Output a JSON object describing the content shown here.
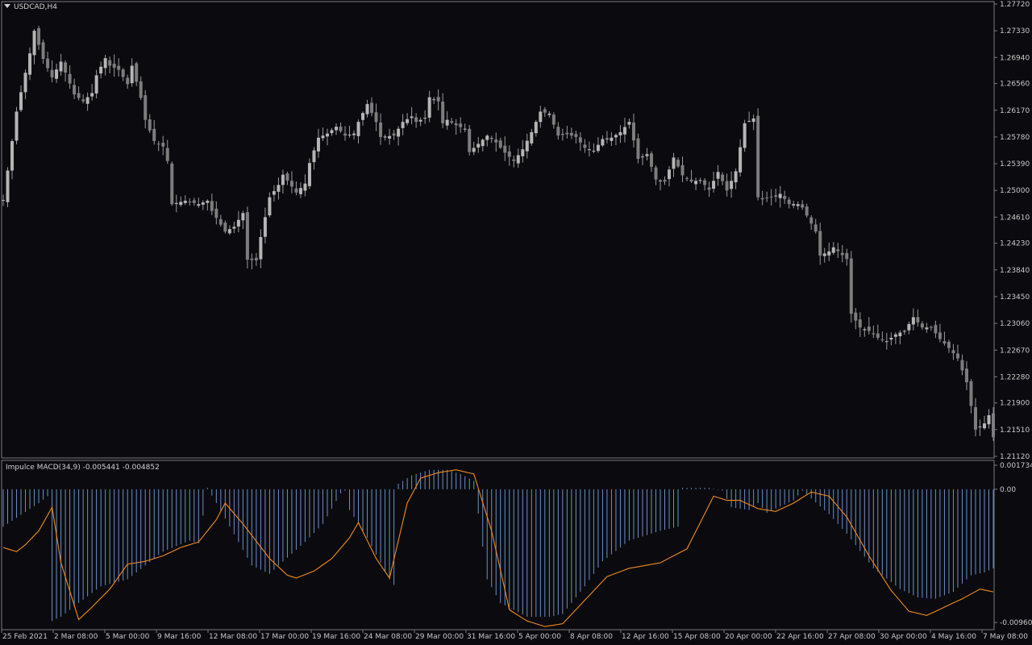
{
  "main_chart": {
    "symbol_label": "USDCAD,H4",
    "price_ticks": [
      "1.27720",
      "1.27330",
      "1.26940",
      "1.26560",
      "1.26170",
      "1.25780",
      "1.25390",
      "1.25000",
      "1.24610",
      "1.24230",
      "1.23840",
      "1.23450",
      "1.23060",
      "1.22670",
      "1.22280",
      "1.21900",
      "1.21510",
      "1.21120"
    ]
  },
  "indicator": {
    "label": "Impulce MACD(34,9) -0.005441 -0.004852",
    "value_ticks": [
      "0.001734",
      "0.00",
      "-0.009605"
    ],
    "histogram_color": "#6b8fc7",
    "signal_color": "#f28a1e"
  },
  "time_axis": {
    "labels": [
      "25 Feb 2021",
      "2 Mar 08:00",
      "5 Mar 00:00",
      "9 Mar 16:00",
      "12 Mar 08:00",
      "17 Mar 00:00",
      "19 Mar 16:00",
      "24 Mar 08:00",
      "29 Mar 00:00",
      "31 Mar 16:00",
      "5 Apr 00:00",
      "8 Apr 08:00",
      "12 Apr 16:00",
      "15 Apr 08:00",
      "20 Apr 00:00",
      "22 Apr 16:00",
      "27 Apr 08:00",
      "30 Apr 00:00",
      "4 May 16:00",
      "7 May 08:00"
    ]
  },
  "chart_data": {
    "type": "candlestick",
    "symbol": "USDCAD",
    "timeframe": "H4",
    "ylim": [
      1.2112,
      1.2772
    ],
    "close_path": [
      [
        0,
        1.2486
      ],
      [
        3,
        1.2615
      ],
      [
        6,
        1.27
      ],
      [
        7,
        1.2733
      ],
      [
        9,
        1.2692
      ],
      [
        11,
        1.2665
      ],
      [
        13,
        1.2688
      ],
      [
        16,
        1.264
      ],
      [
        18,
        1.263
      ],
      [
        20,
        1.2642
      ],
      [
        21,
        1.2668
      ],
      [
        23,
        1.2693
      ],
      [
        24,
        1.2682
      ],
      [
        26,
        1.2676
      ],
      [
        28,
        1.2655
      ],
      [
        29,
        1.2682
      ],
      [
        31,
        1.2635
      ],
      [
        32,
        1.2603
      ],
      [
        34,
        1.2572
      ],
      [
        36,
        1.2564
      ],
      [
        37,
        1.2543
      ],
      [
        38,
        1.248
      ],
      [
        41,
        1.2485
      ],
      [
        44,
        1.248
      ],
      [
        46,
        1.2485
      ],
      [
        47,
        1.247
      ],
      [
        50,
        1.244
      ],
      [
        52,
        1.2447
      ],
      [
        54,
        1.2467
      ],
      [
        55,
        1.2399
      ],
      [
        57,
        1.2398
      ],
      [
        58,
        1.2432
      ],
      [
        60,
        1.249
      ],
      [
        62,
        1.2508
      ],
      [
        63,
        1.2523
      ],
      [
        66,
        1.2497
      ],
      [
        68,
        1.251
      ],
      [
        69,
        1.254
      ],
      [
        71,
        1.2577
      ],
      [
        73,
        1.2583
      ],
      [
        75,
        1.2593
      ],
      [
        77,
        1.258
      ],
      [
        79,
        1.2583
      ],
      [
        80,
        1.26
      ],
      [
        82,
        1.2626
      ],
      [
        84,
        1.26
      ],
      [
        85,
        1.2578
      ],
      [
        88,
        1.258
      ],
      [
        90,
        1.26
      ],
      [
        92,
        1.2608
      ],
      [
        93,
        1.26
      ],
      [
        95,
        1.2606
      ],
      [
        96,
        1.2636
      ],
      [
        98,
        1.263
      ],
      [
        99,
        1.2598
      ],
      [
        100,
        1.2603
      ],
      [
        102,
        1.2595
      ],
      [
        104,
        1.259
      ],
      [
        105,
        1.2556
      ],
      [
        107,
        1.2568
      ],
      [
        109,
        1.258
      ],
      [
        111,
        1.257
      ],
      [
        113,
        1.2555
      ],
      [
        115,
        1.2543
      ],
      [
        117,
        1.256
      ],
      [
        119,
        1.2585
      ],
      [
        121,
        1.2615
      ],
      [
        123,
        1.2612
      ],
      [
        125,
        1.258
      ],
      [
        127,
        1.2582
      ],
      [
        129,
        1.2578
      ],
      [
        131,
        1.2562
      ],
      [
        133,
        1.2558
      ],
      [
        135,
        1.2575
      ],
      [
        137,
        1.2577
      ],
      [
        139,
        1.2585
      ],
      [
        141,
        1.26
      ],
      [
        143,
        1.2546
      ],
      [
        145,
        1.2553
      ],
      [
        147,
        1.2516
      ],
      [
        149,
        1.2513
      ],
      [
        151,
        1.2548
      ],
      [
        153,
        1.2522
      ],
      [
        155,
        1.2513
      ],
      [
        157,
        1.2515
      ],
      [
        159,
        1.2501
      ],
      [
        161,
        1.2527
      ],
      [
        163,
        1.25
      ],
      [
        165,
        1.2528
      ],
      [
        167,
        1.2598
      ],
      [
        169,
        1.2605
      ],
      [
        170,
        1.249
      ],
      [
        171,
        1.2487
      ],
      [
        173,
        1.249
      ],
      [
        175,
        1.2495
      ],
      [
        177,
        1.248
      ],
      [
        179,
        1.248
      ],
      [
        180,
        1.2475
      ],
      [
        183,
        1.244
      ],
      [
        184,
        1.2405
      ],
      [
        186,
        1.2411
      ],
      [
        187,
        1.2417
      ],
      [
        190,
        1.24
      ],
      [
        191,
        1.232
      ],
      [
        193,
        1.23
      ],
      [
        195,
        1.2295
      ],
      [
        197,
        1.2285
      ],
      [
        199,
        1.228
      ],
      [
        201,
        1.229
      ],
      [
        203,
        1.2295
      ],
      [
        205,
        1.2315
      ],
      [
        207,
        1.23
      ],
      [
        209,
        1.23
      ],
      [
        211,
        1.2283
      ],
      [
        213,
        1.227
      ],
      [
        215,
        1.2255
      ],
      [
        217,
        1.222
      ],
      [
        219,
        1.2151
      ],
      [
        221,
        1.216
      ],
      [
        222,
        1.2172
      ],
      [
        223,
        1.214
      ]
    ],
    "indicator": {
      "name": "Impulce MACD",
      "params": [
        34,
        9
      ],
      "main_value": -0.005441,
      "signal_value": -0.004852,
      "ylim": [
        -0.009605,
        0.001734
      ],
      "histogram_path": [
        [
          0,
          -0.0027
        ],
        [
          8,
          -0.001
        ],
        [
          10,
          -0.0005
        ],
        [
          11,
          -0.0095
        ],
        [
          13,
          -0.0092
        ],
        [
          17,
          -0.0082
        ],
        [
          22,
          -0.007
        ],
        [
          28,
          -0.0065
        ],
        [
          36,
          -0.0045
        ],
        [
          42,
          -0.0037
        ],
        [
          44,
          -0.0039
        ],
        [
          46,
          0.0001
        ],
        [
          48,
          -0.001
        ],
        [
          56,
          -0.0055
        ],
        [
          60,
          -0.0061
        ],
        [
          62,
          -0.0055
        ],
        [
          68,
          -0.0038
        ],
        [
          72,
          -0.0025
        ],
        [
          76,
          -0.0003
        ],
        [
          77,
          -0.0001
        ],
        [
          78,
          -0.0015
        ],
        [
          82,
          -0.0035
        ],
        [
          87,
          -0.0065
        ],
        [
          88,
          -0.0069
        ],
        [
          89,
          0.0004
        ],
        [
          92,
          0.001
        ],
        [
          96,
          0.0014
        ],
        [
          100,
          0.0014
        ],
        [
          103,
          0.0011
        ],
        [
          106,
          0.0006
        ],
        [
          109,
          -0.0065
        ],
        [
          112,
          -0.0082
        ],
        [
          118,
          -0.0092
        ],
        [
          123,
          -0.0092
        ],
        [
          126,
          -0.009
        ],
        [
          131,
          -0.007
        ],
        [
          135,
          -0.0052
        ],
        [
          141,
          -0.0037
        ],
        [
          148,
          -0.003
        ],
        [
          152,
          -0.0027
        ],
        [
          153,
          0.0001
        ],
        [
          156,
          0.0001
        ],
        [
          159,
          0.0001
        ],
        [
          162,
          -0.0001
        ],
        [
          164,
          -0.0013
        ],
        [
          166,
          -0.0014
        ],
        [
          168,
          -0.0015
        ],
        [
          170,
          -0.001
        ],
        [
          172,
          -0.0017
        ],
        [
          178,
          -0.0008
        ],
        [
          180,
          -0.0001
        ],
        [
          186,
          -0.0018
        ],
        [
          190,
          -0.0032
        ],
        [
          196,
          -0.0057
        ],
        [
          202,
          -0.0072
        ],
        [
          206,
          -0.0078
        ],
        [
          210,
          -0.0079
        ],
        [
          214,
          -0.0074
        ],
        [
          218,
          -0.0062
        ],
        [
          221,
          -0.006
        ],
        [
          223,
          -0.0057
        ]
      ],
      "signal_path": [
        [
          0,
          -0.0042
        ],
        [
          3,
          -0.0045
        ],
        [
          5,
          -0.004
        ],
        [
          8,
          -0.003
        ],
        [
          11,
          -0.0013
        ],
        [
          13,
          -0.0053
        ],
        [
          17,
          -0.0094
        ],
        [
          20,
          -0.0085
        ],
        [
          24,
          -0.0072
        ],
        [
          28,
          -0.0054
        ],
        [
          32,
          -0.0052
        ],
        [
          36,
          -0.0048
        ],
        [
          40,
          -0.0042
        ],
        [
          44,
          -0.0038
        ],
        [
          48,
          -0.0022
        ],
        [
          50,
          -0.001
        ],
        [
          54,
          -0.0025
        ],
        [
          60,
          -0.005
        ],
        [
          64,
          -0.0062
        ],
        [
          66,
          -0.0064
        ],
        [
          70,
          -0.0059
        ],
        [
          74,
          -0.005
        ],
        [
          78,
          -0.0035
        ],
        [
          80,
          -0.0024
        ],
        [
          84,
          -0.005
        ],
        [
          87,
          -0.0064
        ],
        [
          91,
          -0.001
        ],
        [
          94,
          0.0008
        ],
        [
          98,
          0.0012
        ],
        [
          102,
          0.0014
        ],
        [
          106,
          0.0011
        ],
        [
          110,
          -0.003
        ],
        [
          114,
          -0.0087
        ],
        [
          118,
          -0.0095
        ],
        [
          122,
          -0.0099
        ],
        [
          126,
          -0.0097
        ],
        [
          131,
          -0.008
        ],
        [
          136,
          -0.0063
        ],
        [
          141,
          -0.0057
        ],
        [
          148,
          -0.0053
        ],
        [
          154,
          -0.0043
        ],
        [
          160,
          -0.0005
        ],
        [
          163,
          -0.0008
        ],
        [
          166,
          -0.0008
        ],
        [
          170,
          -0.0014
        ],
        [
          174,
          -0.0016
        ],
        [
          178,
          -0.001
        ],
        [
          182,
          -0.0002
        ],
        [
          186,
          -0.0005
        ],
        [
          190,
          -0.002
        ],
        [
          195,
          -0.0048
        ],
        [
          200,
          -0.0073
        ],
        [
          204,
          -0.0088
        ],
        [
          208,
          -0.0091
        ],
        [
          212,
          -0.0085
        ],
        [
          216,
          -0.0079
        ],
        [
          220,
          -0.0072
        ],
        [
          223,
          -0.0074
        ]
      ]
    }
  }
}
